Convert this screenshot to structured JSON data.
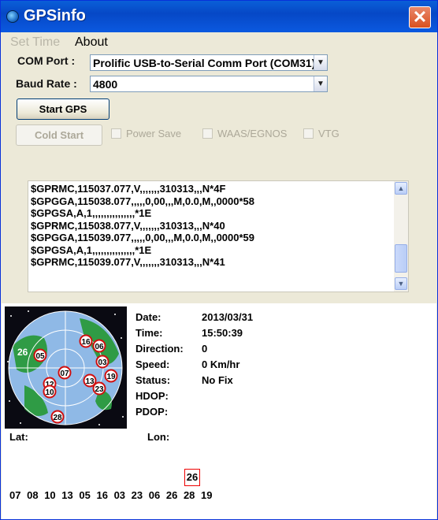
{
  "window": {
    "title": "GPSinfo",
    "close": "✕"
  },
  "menu": {
    "set_time": "Set Time",
    "about": "About"
  },
  "com_port": {
    "label": "COM Port :",
    "value": "Prolific USB-to-Serial Comm Port (COM31)"
  },
  "baud_rate": {
    "label": "Baud Rate :",
    "value": "4800"
  },
  "buttons": {
    "start_gps": "Start GPS",
    "cold_start": "Cold Start"
  },
  "options": {
    "power_save": "Power Save",
    "waas": "WAAS/EGNOS",
    "vtg": "VTG"
  },
  "nmea": [
    "$GPRMC,115037.077,V,,,,,,,310313,,,N*4F",
    "$GPGGA,115038.077,,,,,0,00,,,M,0.0,M,,0000*58",
    "$GPGSA,A,1,,,,,,,,,,,,,,,*1E",
    "$GPRMC,115038.077,V,,,,,,,310313,,,N*40",
    "$GPGGA,115039.077,,,,,0,00,,,M,0.0,M,,0000*59",
    "$GPGSA,A,1,,,,,,,,,,,,,,,*1E",
    "$GPRMC,115039.077,V,,,,,,,310313,,,N*41"
  ],
  "info": {
    "date_label": "Date:",
    "date": "2013/03/31",
    "time_label": "Time:",
    "time": "15:50:39",
    "direction_label": "Direction:",
    "direction": "0",
    "speed_label": "Speed:",
    "speed": "0 Km/hr",
    "status_label": "Status:",
    "status": "No Fix",
    "hdop_label": "HDOP:",
    "hdop": "",
    "pdop_label": "PDOP:",
    "pdop": "",
    "lat_label": "Lat:",
    "lat": "",
    "lon_label": "Lon:",
    "lon": ""
  },
  "sky_satellites": [
    "26",
    "05",
    "16",
    "06",
    "03",
    "19",
    "07",
    "13",
    "23",
    "12",
    "10",
    "28"
  ],
  "signal_bar": {
    "label": "26"
  },
  "satellite_ids": [
    "07",
    "08",
    "10",
    "13",
    "05",
    "16",
    "03",
    "23",
    "06",
    "26",
    "28",
    "19"
  ]
}
